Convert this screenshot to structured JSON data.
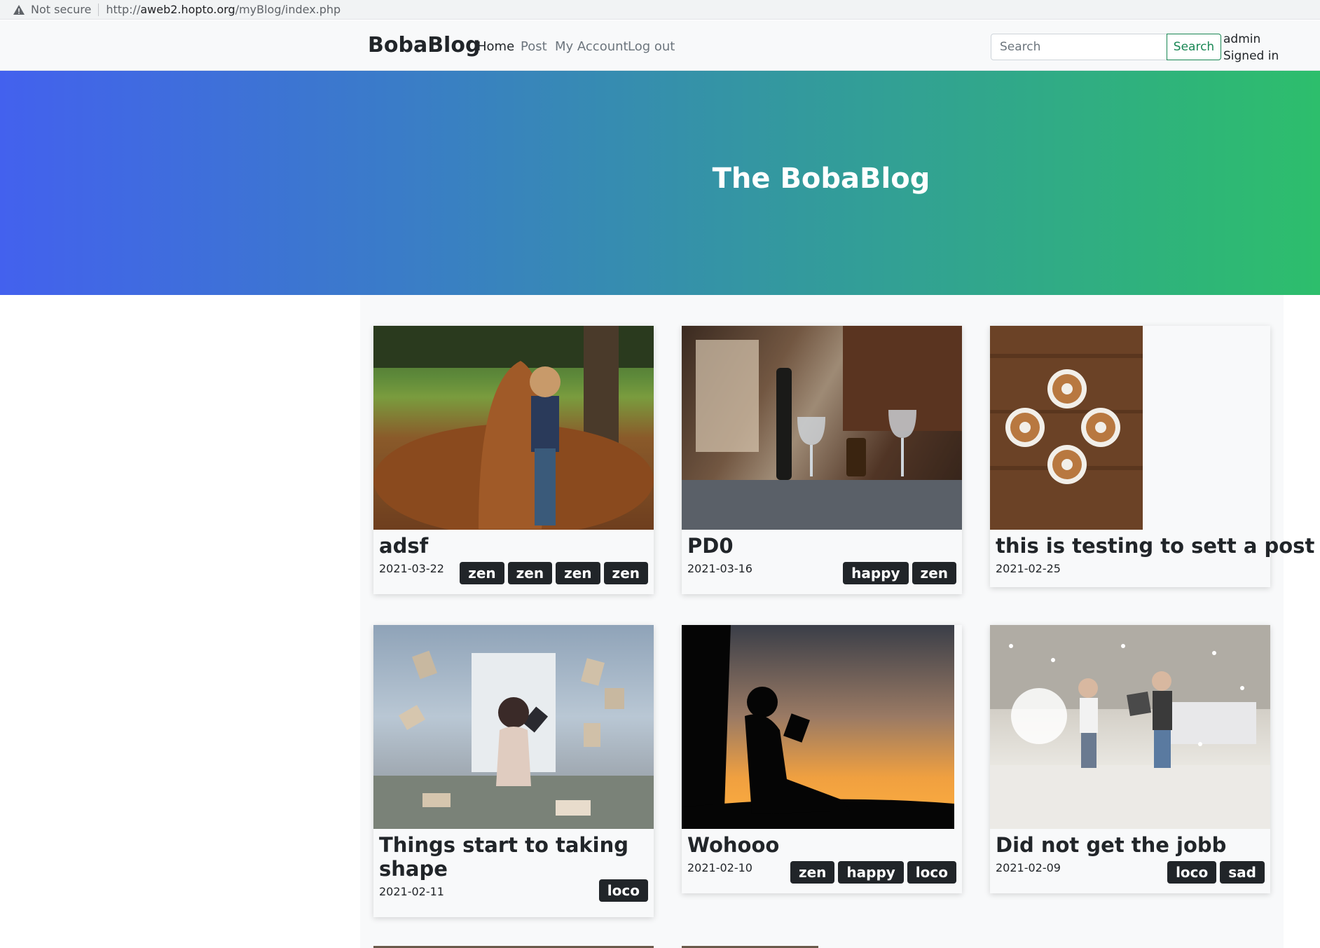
{
  "browser": {
    "security": "Not secure",
    "url_prefix": "http://",
    "url_host": "aweb2.hopto.org",
    "url_path": "/myBlog/index.php"
  },
  "nav": {
    "brand": "BobaBlog",
    "links": [
      "Home",
      "Post",
      "My Account",
      "Log out"
    ],
    "search_placeholder": "Search",
    "search_button": "Search",
    "user": "admin",
    "status": "Signed in"
  },
  "hero": {
    "title": "The BobaBlog"
  },
  "posts": [
    {
      "title": "adsf",
      "date": "2021-03-22",
      "tags": [
        "zen",
        "zen",
        "zen",
        "zen"
      ]
    },
    {
      "title": "PD0",
      "date": "2021-03-16",
      "tags": [
        "happy",
        "zen"
      ]
    },
    {
      "title": "this is testing to sett a post",
      "date": "2021-02-25",
      "tags": []
    },
    {
      "title": "Things start to taking shape",
      "date": "2021-02-11",
      "tags": [
        "loco"
      ]
    },
    {
      "title": "Wohooo",
      "date": "2021-02-10",
      "tags": [
        "zen",
        "happy",
        "loco"
      ]
    },
    {
      "title": "Did not get the jobb",
      "date": "2021-02-09",
      "tags": [
        "loco",
        "sad"
      ]
    }
  ]
}
